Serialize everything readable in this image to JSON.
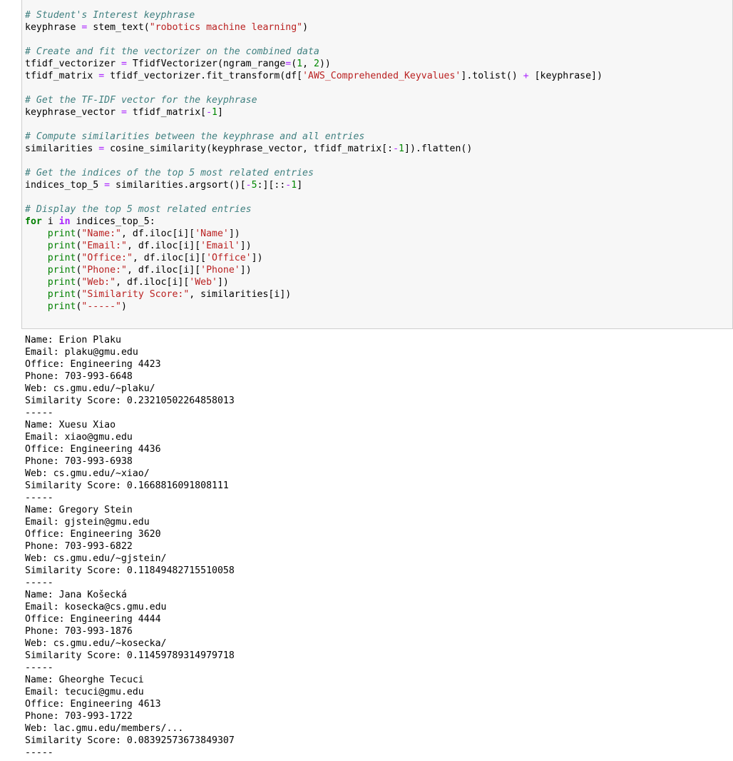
{
  "code_cell": {
    "lines": [
      {
        "tokens": [
          {
            "t": "c",
            "v": "# Student's Interest keyphrase"
          }
        ]
      },
      {
        "tokens": [
          {
            "t": "p",
            "v": "keyphrase "
          },
          {
            "t": "o",
            "v": "="
          },
          {
            "t": "p",
            "v": " stem_text("
          },
          {
            "t": "s",
            "v": "\"robotics machine learning\""
          },
          {
            "t": "p",
            "v": ")"
          }
        ]
      },
      {
        "tokens": []
      },
      {
        "tokens": [
          {
            "t": "c",
            "v": "# Create and fit the vectorizer on the combined data"
          }
        ]
      },
      {
        "tokens": [
          {
            "t": "p",
            "v": "tfidf_vectorizer "
          },
          {
            "t": "o",
            "v": "="
          },
          {
            "t": "p",
            "v": " TfidfVectorizer(ngram_range"
          },
          {
            "t": "o",
            "v": "="
          },
          {
            "t": "p",
            "v": "("
          },
          {
            "t": "m",
            "v": "1"
          },
          {
            "t": "p",
            "v": ", "
          },
          {
            "t": "m",
            "v": "2"
          },
          {
            "t": "p",
            "v": "))"
          }
        ]
      },
      {
        "tokens": [
          {
            "t": "p",
            "v": "tfidf_matrix "
          },
          {
            "t": "o",
            "v": "="
          },
          {
            "t": "p",
            "v": " tfidf_vectorizer.fit_transform(df["
          },
          {
            "t": "s",
            "v": "'AWS_Comprehended_Keyvalues'"
          },
          {
            "t": "p",
            "v": "].tolist() "
          },
          {
            "t": "o",
            "v": "+"
          },
          {
            "t": "p",
            "v": " [keyphrase])"
          }
        ]
      },
      {
        "tokens": []
      },
      {
        "tokens": [
          {
            "t": "c",
            "v": "# Get the TF-IDF vector for the keyphrase"
          }
        ]
      },
      {
        "tokens": [
          {
            "t": "p",
            "v": "keyphrase_vector "
          },
          {
            "t": "o",
            "v": "="
          },
          {
            "t": "p",
            "v": " tfidf_matrix["
          },
          {
            "t": "o",
            "v": "-"
          },
          {
            "t": "m",
            "v": "1"
          },
          {
            "t": "p",
            "v": "]"
          }
        ]
      },
      {
        "tokens": []
      },
      {
        "tokens": [
          {
            "t": "c",
            "v": "# Compute similarities between the keyphrase and all entries"
          }
        ]
      },
      {
        "tokens": [
          {
            "t": "p",
            "v": "similarities "
          },
          {
            "t": "o",
            "v": "="
          },
          {
            "t": "p",
            "v": " cosine_similarity(keyphrase_vector, tfidf_matrix[:"
          },
          {
            "t": "o",
            "v": "-"
          },
          {
            "t": "m",
            "v": "1"
          },
          {
            "t": "p",
            "v": "]).flatten()"
          }
        ]
      },
      {
        "tokens": []
      },
      {
        "tokens": [
          {
            "t": "c",
            "v": "# Get the indices of the top 5 most related entries"
          }
        ]
      },
      {
        "tokens": [
          {
            "t": "p",
            "v": "indices_top_5 "
          },
          {
            "t": "o",
            "v": "="
          },
          {
            "t": "p",
            "v": " similarities.argsort()["
          },
          {
            "t": "o",
            "v": "-"
          },
          {
            "t": "m",
            "v": "5"
          },
          {
            "t": "p",
            "v": ":][::"
          },
          {
            "t": "o",
            "v": "-"
          },
          {
            "t": "m",
            "v": "1"
          },
          {
            "t": "p",
            "v": "]"
          }
        ]
      },
      {
        "tokens": []
      },
      {
        "tokens": [
          {
            "t": "c",
            "v": "# Display the top 5 most related entries"
          }
        ]
      },
      {
        "tokens": [
          {
            "t": "k",
            "v": "for"
          },
          {
            "t": "p",
            "v": " i "
          },
          {
            "t": "ow",
            "v": "in"
          },
          {
            "t": "p",
            "v": " indices_top_5:"
          }
        ]
      },
      {
        "tokens": [
          {
            "t": "p",
            "v": "    "
          },
          {
            "t": "b",
            "v": "print"
          },
          {
            "t": "p",
            "v": "("
          },
          {
            "t": "s",
            "v": "\"Name:\""
          },
          {
            "t": "p",
            "v": ", df.iloc[i]["
          },
          {
            "t": "s",
            "v": "'Name'"
          },
          {
            "t": "p",
            "v": "])"
          }
        ]
      },
      {
        "tokens": [
          {
            "t": "p",
            "v": "    "
          },
          {
            "t": "b",
            "v": "print"
          },
          {
            "t": "p",
            "v": "("
          },
          {
            "t": "s",
            "v": "\"Email:\""
          },
          {
            "t": "p",
            "v": ", df.iloc[i]["
          },
          {
            "t": "s",
            "v": "'Email'"
          },
          {
            "t": "p",
            "v": "])"
          }
        ]
      },
      {
        "tokens": [
          {
            "t": "p",
            "v": "    "
          },
          {
            "t": "b",
            "v": "print"
          },
          {
            "t": "p",
            "v": "("
          },
          {
            "t": "s",
            "v": "\"Office:\""
          },
          {
            "t": "p",
            "v": ", df.iloc[i]["
          },
          {
            "t": "s",
            "v": "'Office'"
          },
          {
            "t": "p",
            "v": "])"
          }
        ]
      },
      {
        "tokens": [
          {
            "t": "p",
            "v": "    "
          },
          {
            "t": "b",
            "v": "print"
          },
          {
            "t": "p",
            "v": "("
          },
          {
            "t": "s",
            "v": "\"Phone:\""
          },
          {
            "t": "p",
            "v": ", df.iloc[i]["
          },
          {
            "t": "s",
            "v": "'Phone'"
          },
          {
            "t": "p",
            "v": "])"
          }
        ]
      },
      {
        "tokens": [
          {
            "t": "p",
            "v": "    "
          },
          {
            "t": "b",
            "v": "print"
          },
          {
            "t": "p",
            "v": "("
          },
          {
            "t": "s",
            "v": "\"Web:\""
          },
          {
            "t": "p",
            "v": ", df.iloc[i]["
          },
          {
            "t": "s",
            "v": "'Web'"
          },
          {
            "t": "p",
            "v": "])"
          }
        ]
      },
      {
        "tokens": [
          {
            "t": "p",
            "v": "    "
          },
          {
            "t": "b",
            "v": "print"
          },
          {
            "t": "p",
            "v": "("
          },
          {
            "t": "s",
            "v": "\"Similarity Score:\""
          },
          {
            "t": "p",
            "v": ", similarities[i])"
          }
        ]
      },
      {
        "tokens": [
          {
            "t": "p",
            "v": "    "
          },
          {
            "t": "b",
            "v": "print"
          },
          {
            "t": "p",
            "v": "("
          },
          {
            "t": "s",
            "v": "\"-----\""
          },
          {
            "t": "p",
            "v": ")"
          }
        ]
      }
    ]
  },
  "output": {
    "lines": [
      "Name: Erion Plaku",
      "Email: plaku@gmu.edu",
      "Office: Engineering 4423",
      "Phone: 703-993-6648",
      "Web: cs.gmu.edu/~plaku/",
      "Similarity Score: 0.23210502264858013",
      "-----",
      "Name: Xuesu Xiao",
      "Email: xiao@gmu.edu",
      "Office: Engineering 4436",
      "Phone: 703-993-6938",
      "Web: cs.gmu.edu/~xiao/",
      "Similarity Score: 0.1668816091808111",
      "-----",
      "Name: Gregory Stein",
      "Email: gjstein@gmu.edu",
      "Office: Engineering 3620",
      "Phone: 703-993-6822",
      "Web: cs.gmu.edu/~gjstein/",
      "Similarity Score: 0.11849482715510058",
      "-----",
      "Name: Jana Košecká",
      "Email: kosecka@cs.gmu.edu",
      "Office: Engineering 4444",
      "Phone: 703-993-1876",
      "Web: cs.gmu.edu/~kosecka/",
      "Similarity Score: 0.11459789314979718",
      "-----",
      "Name: Gheorghe Tecuci",
      "Email: tecuci@gmu.edu",
      "Office: Engineering 4613",
      "Phone: 703-993-1722",
      "Web: lac.gmu.edu/members/...",
      "Similarity Score: 0.08392573673849307",
      "-----"
    ]
  },
  "colors": {
    "cell_background": "#f7f7f7",
    "cell_border": "#cfcfcf",
    "comment": "#408080",
    "keyword": "#008000",
    "string": "#ba2121",
    "operator": "#aa22ff",
    "number": "#008800"
  }
}
